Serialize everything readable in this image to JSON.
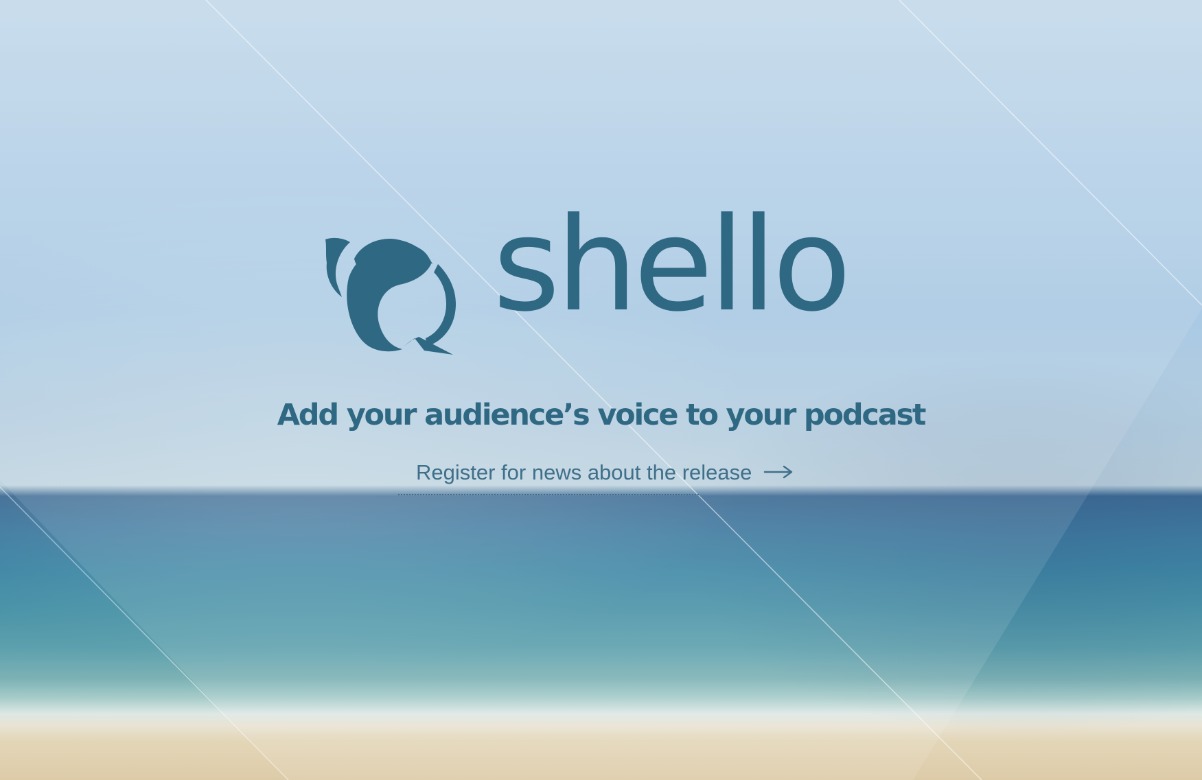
{
  "brand": {
    "name": "shello",
    "color": "#2f6882",
    "logo_icon": "speech-shell-icon"
  },
  "hero": {
    "tagline": "Add your audience’s voice to your podcast",
    "register_label": "Register for news about the release",
    "register_icon": "arrow-right-icon"
  },
  "background": {
    "scene": "beach-sea-sky",
    "sky_color": "#b6d1e8",
    "sea_color": "#3f87a5",
    "sand_color": "#ddcba8"
  }
}
